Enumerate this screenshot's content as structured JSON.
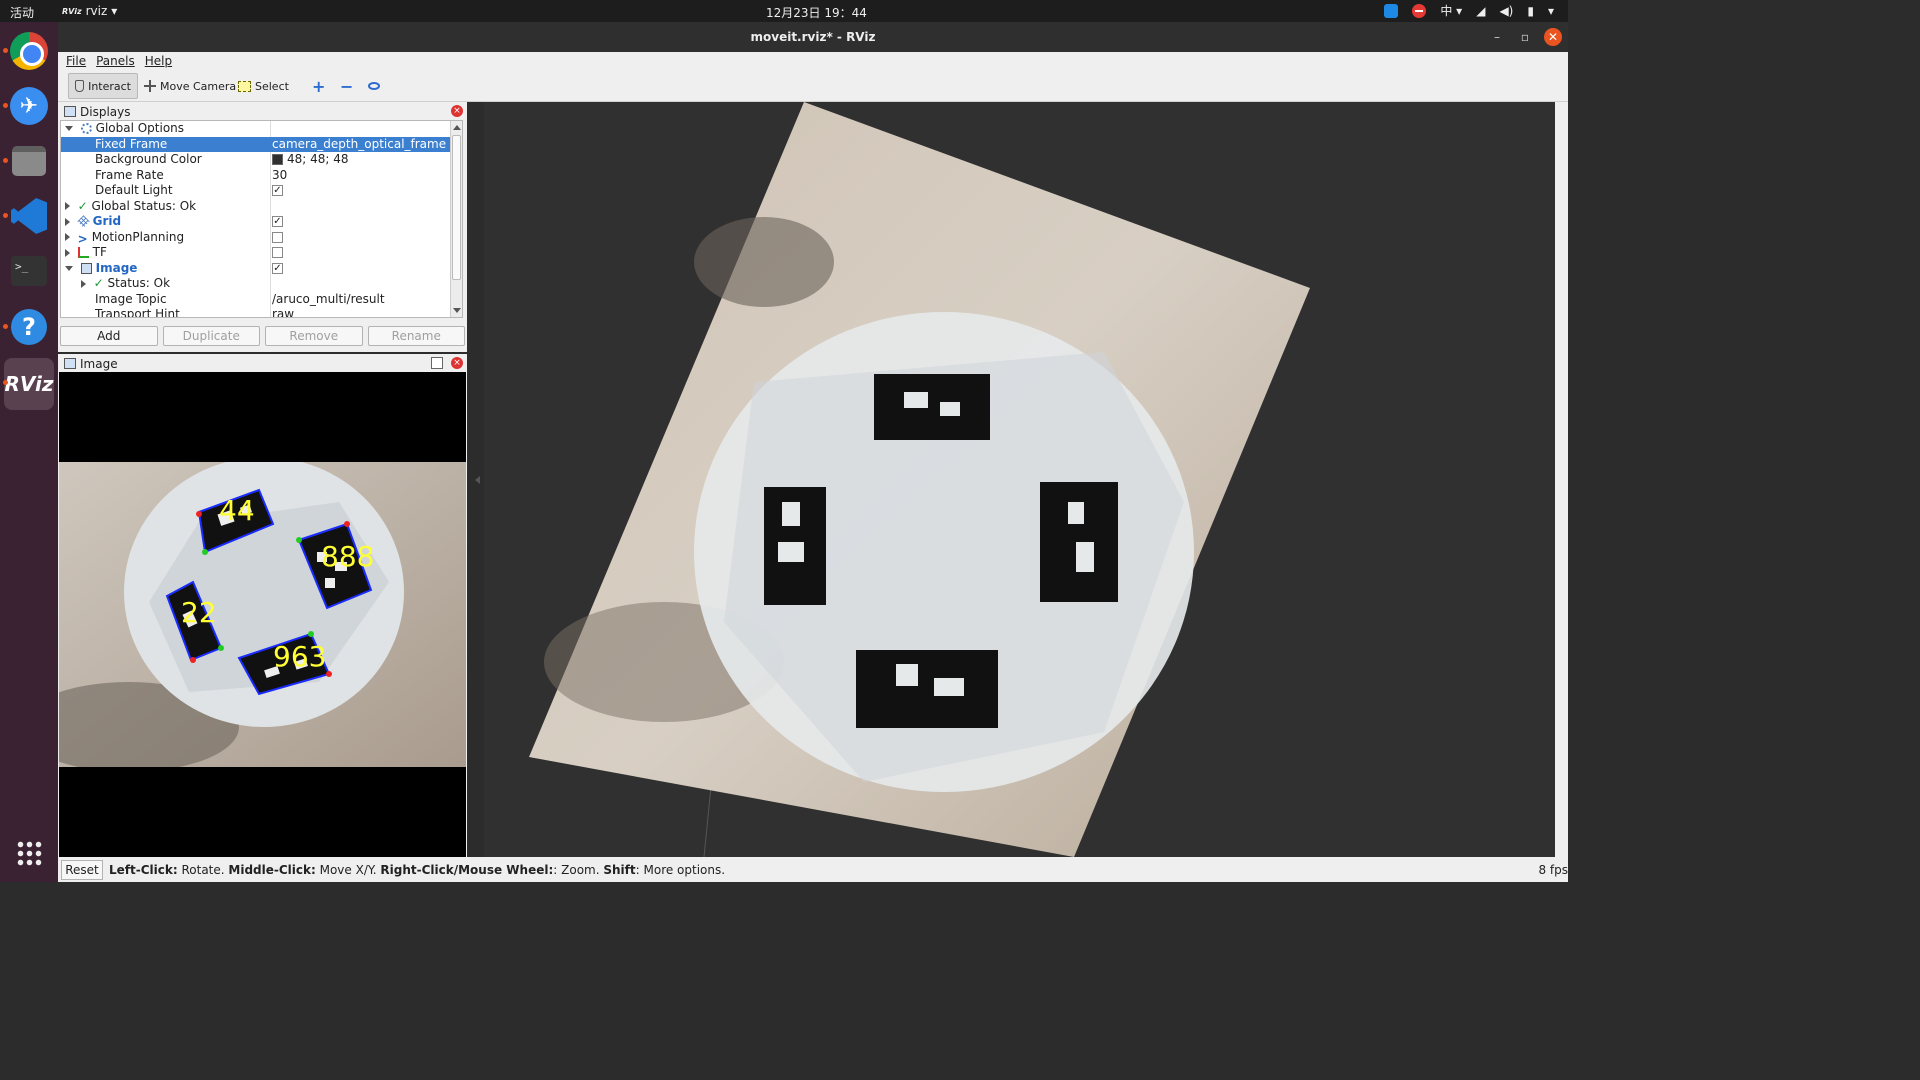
{
  "topbar": {
    "activities": "活动",
    "app_name": "rviz",
    "app_logo": "RViz",
    "clock": "12月23日  19：44",
    "input_method": "中",
    "tray_icons": [
      "task-badge-icon",
      "do-not-disturb-icon",
      "input-method-icon",
      "wifi-icon",
      "volume-icon",
      "battery-icon",
      "power-menu-icon"
    ]
  },
  "dock": {
    "apps": [
      "chrome",
      "feishu",
      "files",
      "vscode",
      "terminal",
      "help",
      "rviz"
    ],
    "rviz_label": "RViz",
    "terminal_label": ">_",
    "help_label": "?"
  },
  "window": {
    "title": "moveit.rviz* - RViz",
    "minimize": "–",
    "maximize": "▫",
    "close": "✕"
  },
  "menu": {
    "file": "File",
    "panels": "Panels",
    "help": "Help"
  },
  "toolbar": {
    "interact": "Interact",
    "move_camera": "Move Camera",
    "select": "Select",
    "plus": "+",
    "minus": "−"
  },
  "displays": {
    "title": "Displays",
    "close": "×",
    "rows": [
      {
        "label": "Global Options",
        "value": ""
      },
      {
        "label": "Fixed Frame",
        "value": "camera_depth_optical_frame"
      },
      {
        "label": "Background Color",
        "value": "48; 48; 48"
      },
      {
        "label": "Frame Rate",
        "value": "30"
      },
      {
        "label": "Default Light",
        "value": "✓"
      },
      {
        "label": "Global Status: Ok",
        "value": ""
      },
      {
        "label": "Grid",
        "value": "✓"
      },
      {
        "label": "MotionPlanning",
        "value": ""
      },
      {
        "label": "TF",
        "value": ""
      },
      {
        "label": "Image",
        "value": "✓"
      },
      {
        "label": "Status: Ok",
        "value": ""
      },
      {
        "label": "Image Topic",
        "value": "/aruco_multi/result"
      },
      {
        "label": "Transport Hint",
        "value": "raw"
      }
    ],
    "buttons": {
      "add": "Add",
      "duplicate": "Duplicate",
      "remove": "Remove",
      "rename": "Rename"
    }
  },
  "image_panel": {
    "title": "Image",
    "close": "×",
    "marker_ids": [
      "44",
      "888",
      "22",
      "963"
    ]
  },
  "statusbar": {
    "reset": "Reset",
    "hint_1_key": "Left-Click:",
    "hint_1_text": " Rotate. ",
    "hint_2_key": "Middle-Click:",
    "hint_2_text": " Move X/Y. ",
    "hint_3_key": "Right-Click/Mouse Wheel:",
    "hint_3_text": ": Zoom. ",
    "hint_4_key": "Shift",
    "hint_4_text": ": More options.",
    "fps": "8 fps"
  },
  "colors": {
    "selection": "#3a7fd0",
    "background_3d": "#303030",
    "ubuntu_orange": "#e95420",
    "dock": "#3a2233",
    "marker_label": "#ffff33",
    "marker_outline": "#1a2cff"
  }
}
